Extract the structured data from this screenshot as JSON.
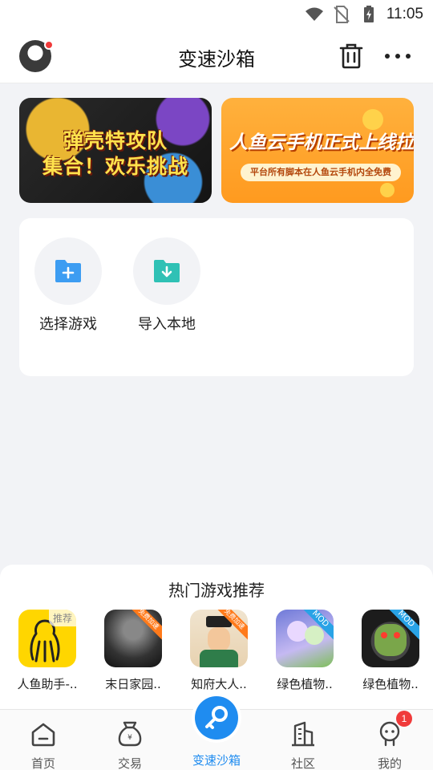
{
  "status_bar": {
    "time": "11:05",
    "icons": [
      "wifi-icon",
      "no-sim-icon",
      "battery-charging-icon"
    ]
  },
  "header": {
    "title": "变速沙箱",
    "trash_icon": "trash-icon",
    "more_icon": "more-dots-icon"
  },
  "banners": [
    {
      "line1": "弹壳特攻队",
      "line2": "集合！欢乐挑战"
    },
    {
      "title": "人鱼云手机正式上线拉",
      "subtitle": "平台所有脚本在人鱼云手机内全免费"
    }
  ],
  "actions": [
    {
      "label": "选择游戏",
      "icon": "folder-add-icon",
      "color": "#3d9df2"
    },
    {
      "label": "导入本地",
      "icon": "folder-import-icon",
      "color": "#2fc1b5"
    }
  ],
  "recommendations": {
    "title": "热门游戏推荐",
    "games": [
      {
        "name": "人鱼助手-..",
        "tag": "推荐"
      },
      {
        "name": "末日家园..",
        "tag": "免费加速"
      },
      {
        "name": "知府大人..",
        "tag": "免费加速"
      },
      {
        "name": "绿色植物..",
        "tag": "MOD"
      },
      {
        "name": "绿色植物..",
        "tag": "MOD"
      }
    ]
  },
  "nav": {
    "items": [
      {
        "label": "首页",
        "icon": "home-icon"
      },
      {
        "label": "交易",
        "icon": "trade-bag-icon"
      },
      {
        "label": "变速沙箱",
        "icon": "speed-key-icon"
      },
      {
        "label": "社区",
        "icon": "community-building-icon"
      },
      {
        "label": "我的",
        "icon": "profile-icon"
      }
    ],
    "active": "变速沙箱",
    "badge_count": "1"
  },
  "colors": {
    "accent": "#1f8cf0",
    "badge": "#f03a3a"
  }
}
